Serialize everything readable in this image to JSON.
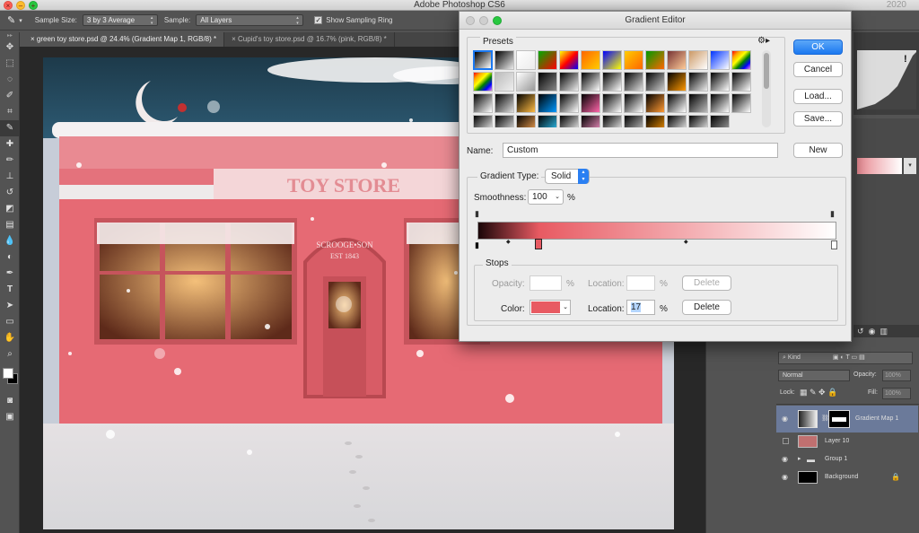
{
  "app": {
    "title": "Adobe Photoshop CS6",
    "right_hint": "2020"
  },
  "options_bar": {
    "sample_size_label": "Sample Size:",
    "sample_size_value": "3 by 3 Average",
    "sample_label": "Sample:",
    "sample_value": "All Layers",
    "sampling_ring_label": "Show Sampling Ring",
    "sampling_ring_checked": true
  },
  "tabs": [
    {
      "label": "green toy store.psd @ 24.4% (Gradient Map 1, RGB/8) *",
      "active": true
    },
    {
      "label": "Cupid's toy store.psd @ 16.7% (pink, RGB/8) *",
      "active": false
    }
  ],
  "tools": [
    "move-tool",
    "marquee-tool",
    "lasso-tool",
    "quick-select-tool",
    "crop-tool",
    "eyedropper-tool",
    "healing-tool",
    "brush-tool",
    "stamp-tool",
    "history-brush-tool",
    "eraser-tool",
    "gradient-tool",
    "blur-tool",
    "dodge-tool",
    "pen-tool",
    "type-tool",
    "path-select-tool",
    "shape-tool",
    "hand-tool",
    "zoom-tool"
  ],
  "artwork": {
    "sign_text": "TOY STORE",
    "door_sign_top": "SCROOGE•SON",
    "door_sign_bottom": "EST 1843"
  },
  "gradient_editor": {
    "title": "Gradient Editor",
    "presets_label": "Presets",
    "buttons": {
      "ok": "OK",
      "cancel": "Cancel",
      "load": "Load...",
      "save": "Save...",
      "new": "New"
    },
    "name_label": "Name:",
    "name_value": "Custom",
    "gradient_type_label": "Gradient Type:",
    "gradient_type_value": "Solid",
    "smoothness_label": "Smoothness:",
    "smoothness_value": "100",
    "smoothness_unit": "%",
    "stops_label": "Stops",
    "opacity_label": "Opacity:",
    "opacity_value": "",
    "opacity_unit": "%",
    "opacity_location_label": "Location:",
    "opacity_location_value": "",
    "opacity_location_unit": "%",
    "delete_label": "Delete",
    "color_label": "Color:",
    "color_value": "#e85a62",
    "color_location_label": "Location:",
    "color_location_value": "17",
    "color_location_unit": "%",
    "color_delete_label": "Delete",
    "gradient_colors": [
      "#1a0608",
      "#e85a62",
      "#ffffff"
    ]
  },
  "layers_panel": {
    "blend_mode": "Normal",
    "opacity_label": "Opacity:",
    "opacity_value": "100%",
    "lock_label": "Lock:",
    "fill_label": "Fill:",
    "fill_value": "100%",
    "kind_label": "Kind",
    "layers": [
      {
        "name": "Gradient Map 1",
        "visible": true,
        "selected": true
      },
      {
        "name": "Layer 10",
        "visible": false,
        "selected": false
      },
      {
        "name": "Group 1",
        "visible": true,
        "selected": false
      },
      {
        "name": "Background",
        "visible": true,
        "selected": false
      }
    ]
  }
}
